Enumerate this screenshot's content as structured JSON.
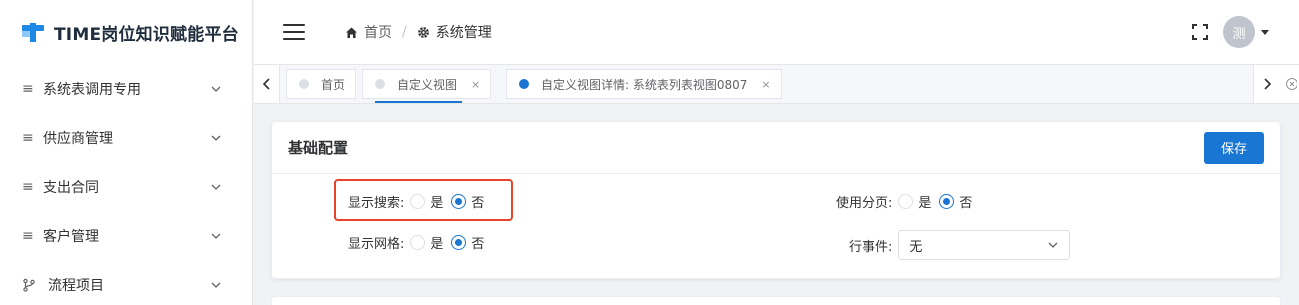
{
  "app": {
    "logo_text": "TIME岗位知识赋能平台"
  },
  "sidebar": {
    "items": [
      {
        "label": "系统表调用专用"
      },
      {
        "label": "供应商管理"
      },
      {
        "label": "支出合同"
      },
      {
        "label": "客户管理"
      },
      {
        "label": "流程项目"
      }
    ]
  },
  "header": {
    "breadcrumb": [
      {
        "label": "首页"
      },
      {
        "label": "系统管理"
      }
    ],
    "breadcrumb_sep": "/",
    "avatar_text": "测"
  },
  "tabs": [
    {
      "label": "首页"
    },
    {
      "label": "自定义视图"
    },
    {
      "label": "自定义视图详情: 系统表列表视图0807"
    }
  ],
  "tab_close": "×",
  "card": {
    "title": "基础配置",
    "save_label": "保存",
    "fields": {
      "show_search": {
        "label": "显示搜索:",
        "options": [
          "是",
          "否"
        ],
        "selected": "否"
      },
      "show_grid": {
        "label": "显示网格:",
        "options": [
          "是",
          "否"
        ],
        "selected": "否"
      },
      "use_paging": {
        "label": "使用分页:",
        "options": [
          "是",
          "否"
        ],
        "selected": "否"
      },
      "row_event": {
        "label": "行事件:",
        "value": "无"
      }
    }
  },
  "colors": {
    "accent": "#1976d2",
    "highlight": "#e8442c"
  }
}
